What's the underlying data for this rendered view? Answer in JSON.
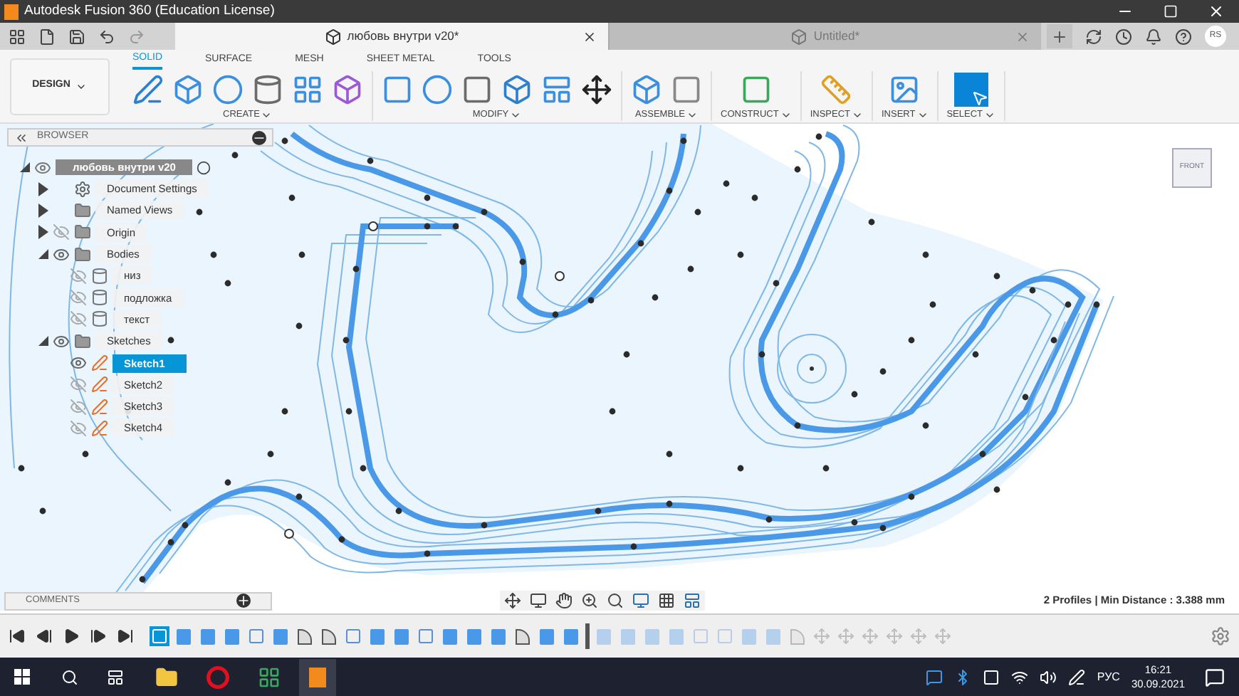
{
  "window": {
    "title": "Autodesk Fusion 360 (Education License)"
  },
  "document_tabs": [
    {
      "title": "любовь внутри v20*",
      "selected": true
    },
    {
      "title": "Untitled*",
      "selected": false
    }
  ],
  "account": {
    "initials": "RS"
  },
  "workspace": {
    "label": "DESIGN"
  },
  "toolbar_tabs": [
    {
      "label": "SOLID",
      "selected": true
    },
    {
      "label": "SURFACE",
      "selected": false
    },
    {
      "label": "MESH",
      "selected": false
    },
    {
      "label": "SHEET METAL",
      "selected": false
    },
    {
      "label": "TOOLS",
      "selected": false
    }
  ],
  "tool_groups": [
    {
      "label": "CREATE"
    },
    {
      "label": "MODIFY"
    },
    {
      "label": "ASSEMBLE"
    },
    {
      "label": "CONSTRUCT"
    },
    {
      "label": "INSPECT"
    },
    {
      "label": "INSERT"
    },
    {
      "label": "SELECT"
    }
  ],
  "browser": {
    "title": "BROWSER",
    "root": {
      "label": "любовь внутри v20",
      "expanded": true,
      "visible": true,
      "children": [
        {
          "label": "Document Settings",
          "kind": "settings",
          "expanded": false
        },
        {
          "label": "Named Views",
          "kind": "folder",
          "expanded": false
        },
        {
          "label": "Origin",
          "kind": "folder",
          "expanded": false,
          "visible": false
        },
        {
          "label": "Bodies",
          "kind": "folder",
          "expanded": true,
          "visible": true,
          "children": [
            {
              "label": "низ",
              "kind": "body",
              "visible": false,
              "selected": false
            },
            {
              "label": "подложка",
              "kind": "body",
              "visible": false,
              "selected": false
            },
            {
              "label": "текст",
              "kind": "body",
              "visible": false,
              "selected": false
            }
          ]
        },
        {
          "label": "Sketches",
          "kind": "folder",
          "expanded": true,
          "visible": true,
          "children": [
            {
              "label": "Sketch1",
              "kind": "sketch",
              "visible": true,
              "selected": true
            },
            {
              "label": "Sketch2",
              "kind": "sketch",
              "visible": false,
              "selected": false
            },
            {
              "label": "Sketch3",
              "kind": "sketch",
              "visible": false,
              "selected": false
            },
            {
              "label": "Sketch4",
              "kind": "sketch",
              "visible": false,
              "selected": false
            }
          ]
        }
      ]
    }
  },
  "viewcube": {
    "label": "FRONT"
  },
  "comments": {
    "title": "COMMENTS"
  },
  "status": "2 Profiles | Min Distance : 3.388 mm",
  "timeline": [
    {
      "kind": "sketch",
      "selected": true,
      "rolled_back": false
    },
    {
      "kind": "extrude",
      "selected": false,
      "rolled_back": false
    },
    {
      "kind": "extrude",
      "selected": false,
      "rolled_back": false
    },
    {
      "kind": "extrude",
      "selected": false,
      "rolled_back": false
    },
    {
      "kind": "sketch",
      "selected": false,
      "rolled_back": false
    },
    {
      "kind": "extrude",
      "selected": false,
      "rolled_back": false
    },
    {
      "kind": "fillet",
      "selected": false,
      "rolled_back": false
    },
    {
      "kind": "fillet",
      "selected": false,
      "rolled_back": false
    },
    {
      "kind": "sketch",
      "selected": false,
      "rolled_back": false
    },
    {
      "kind": "extrude",
      "selected": false,
      "rolled_back": false
    },
    {
      "kind": "extrude",
      "selected": false,
      "rolled_back": false
    },
    {
      "kind": "sketch",
      "selected": false,
      "rolled_back": false
    },
    {
      "kind": "extrude",
      "selected": false,
      "rolled_back": false
    },
    {
      "kind": "extrude",
      "selected": false,
      "rolled_back": false
    },
    {
      "kind": "extrude",
      "selected": false,
      "rolled_back": false
    },
    {
      "kind": "fillet",
      "selected": false,
      "rolled_back": false
    },
    {
      "kind": "extrude",
      "selected": false,
      "rolled_back": false
    },
    {
      "kind": "extrude",
      "selected": false,
      "rolled_back": false
    },
    {
      "kind": "extrude",
      "selected": false,
      "rolled_back": true
    },
    {
      "kind": "extrude",
      "selected": false,
      "rolled_back": true
    },
    {
      "kind": "extrude",
      "selected": false,
      "rolled_back": true
    },
    {
      "kind": "extrude",
      "selected": false,
      "rolled_back": true
    },
    {
      "kind": "sketch",
      "selected": false,
      "rolled_back": true
    },
    {
      "kind": "sketch",
      "selected": false,
      "rolled_back": true
    },
    {
      "kind": "extrude",
      "selected": false,
      "rolled_back": true
    },
    {
      "kind": "extrude",
      "selected": false,
      "rolled_back": true
    },
    {
      "kind": "fillet",
      "selected": false,
      "rolled_back": true
    },
    {
      "kind": "move",
      "selected": false,
      "rolled_back": true
    },
    {
      "kind": "move",
      "selected": false,
      "rolled_back": true
    },
    {
      "kind": "move",
      "selected": false,
      "rolled_back": true
    },
    {
      "kind": "move",
      "selected": false,
      "rolled_back": true
    },
    {
      "kind": "move",
      "selected": false,
      "rolled_back": true
    },
    {
      "kind": "move",
      "selected": false,
      "rolled_back": true
    }
  ],
  "taskbar": {
    "language": "РУС",
    "time": "16:21",
    "date": "30.09.2021"
  }
}
